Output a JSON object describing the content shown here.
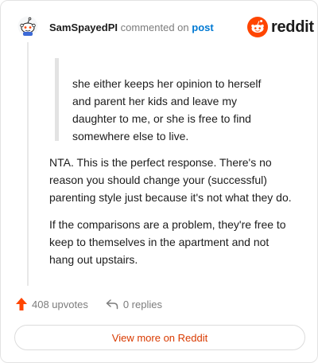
{
  "header": {
    "username": "SamSpayedPI",
    "action": "commented on",
    "post_link": "post",
    "brand": "reddit"
  },
  "comment": {
    "quote": "she either keeps her opinion to herself\nand parent her kids and leave my\ndaughter to me, or she is free to find\nsomewhere else to live.",
    "paragraphs": [
      "NTA. This is the perfect response. There's no\nreason you should change your (successful)\nparenting style just because it's not what they do.",
      "If the comparisons are a problem, they're free to\nkeep to themselves in the apartment and not\nhang out upstairs."
    ]
  },
  "footer": {
    "upvotes": "408 upvotes",
    "replies": "0 replies",
    "view_more": "View more on Reddit"
  },
  "colors": {
    "accent": "#d93a00",
    "reddit_orange": "#ff4500",
    "link_blue": "#0079d3"
  },
  "icons": {
    "avatar": "snoo-avatar-icon",
    "brand": "reddit-logo-icon",
    "upvote": "upvote-arrow-icon",
    "reply": "reply-arrow-icon"
  }
}
